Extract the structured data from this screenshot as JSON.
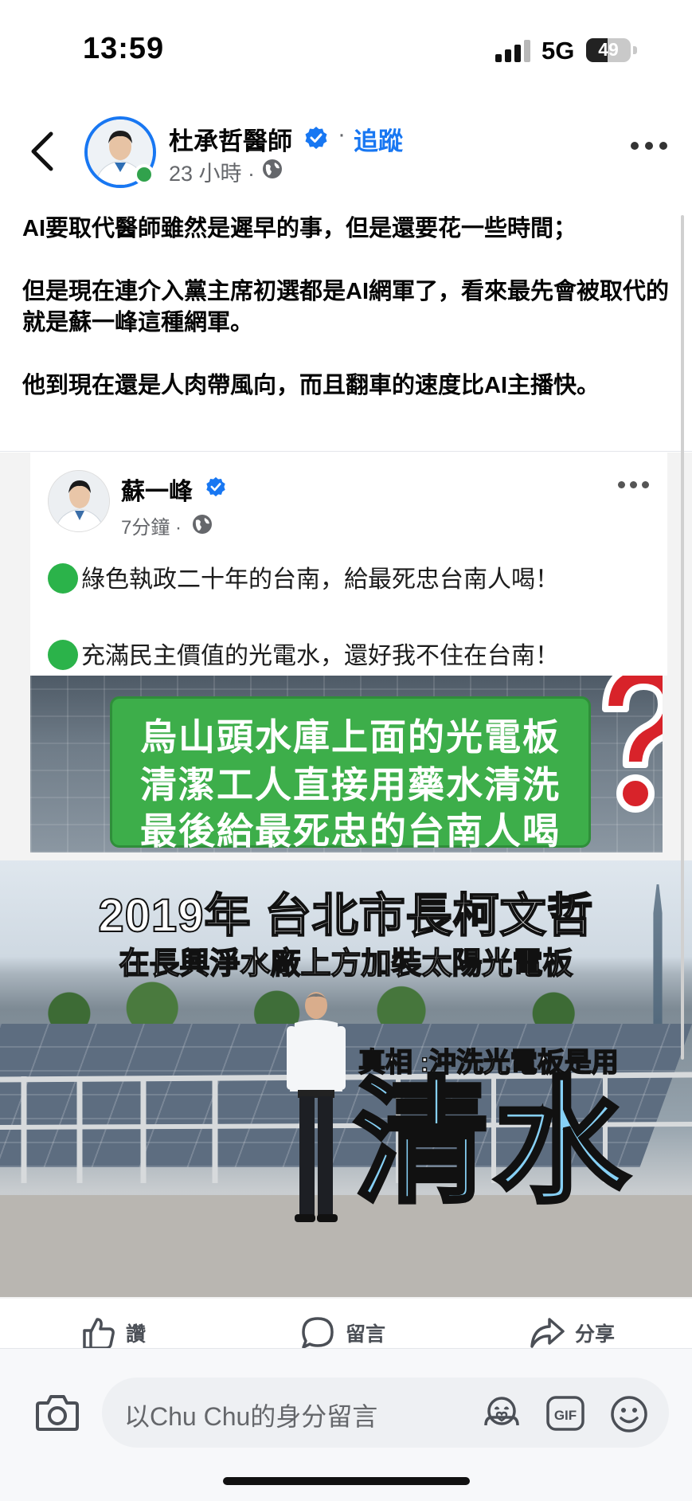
{
  "status_bar": {
    "time": "13:59",
    "network": "5G",
    "battery_level": "49"
  },
  "header": {
    "author_name": "杜承哲醫師",
    "follow_label": "追蹤",
    "separator": "·",
    "post_time": "23 小時 ·",
    "icons": [
      "back-icon",
      "verified-badge-icon",
      "globe-icon",
      "more-options-icon"
    ]
  },
  "post": {
    "paragraphs": [
      "AI要取代醫師雖然是遲早的事，但是還要花一些時間；",
      "但是現在連介入黨主席初選都是AI網軍了，看來最先會被取代的就是蘇一峰這種網軍。",
      "他到現在還是人肉帶風向，而且翻車的速度比AI主播快。"
    ]
  },
  "shared_image": {
    "inner_author": "蘇一峰",
    "inner_time": "7分鐘 ·",
    "inner_lines": [
      "綠色執政二十年的台南，給最死忠台南人喝！",
      "充滿民主價值的光電水，還好我不住在台南！"
    ],
    "sign_lines": [
      "烏山頭水庫上面的光電板",
      "清潔工人直接用藥水清洗",
      "最後給最死忠的台南人喝"
    ],
    "question_mark": "?",
    "headline_1": "2019年 台北市長柯文哲",
    "headline_2": "在長興淨水廠上方加裝太陽光電板",
    "truth_line": "真相 :沖洗光電板是用",
    "truth_big": "清水"
  },
  "actions": {
    "like": "讚",
    "comment": "留言",
    "share": "分享"
  },
  "composer": {
    "placeholder": "以Chu Chu的身分留言",
    "gif_label": "GIF"
  },
  "colors": {
    "accent": "#1877f2",
    "online": "#31a24c",
    "sign_green": "#3dae4a",
    "question_red": "#d8232a",
    "water_blue": "#86d0f5"
  }
}
